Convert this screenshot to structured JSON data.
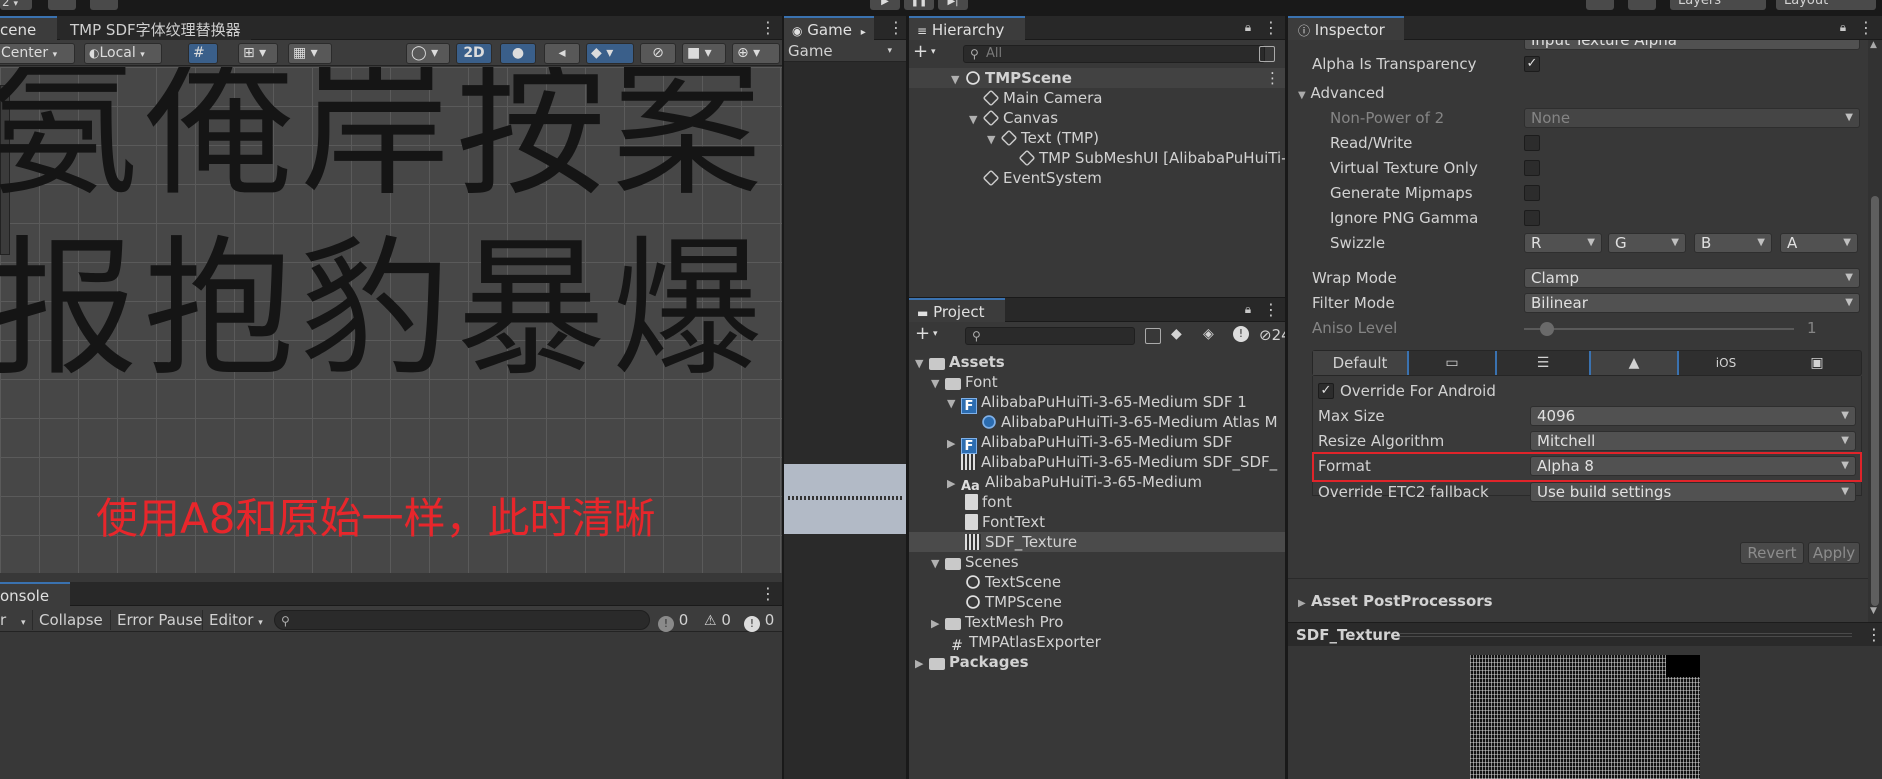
{
  "topbar": {
    "left_value": "2",
    "layers": "Layers",
    "layout": "Layout"
  },
  "scene": {
    "tabs": [
      {
        "label": "cene"
      },
      {
        "label": "TMP SDF字体纹理替换器"
      }
    ],
    "toolbar": {
      "pivot": "Center",
      "space": "Local",
      "mode2d": "2D"
    },
    "glyph_row1": "氨俺岸按案",
    "glyph_row2": "报抱豹暴爆",
    "annotation": "使用A8和原始一样，此时清晰",
    "annotation_color": "#e8262b"
  },
  "console": {
    "tab": "onsole",
    "buttons": {
      "clear": "r",
      "collapse": "Collapse",
      "error_pause": "Error Pause",
      "editor": "Editor"
    },
    "counts": {
      "logs": "0",
      "warnings": "0",
      "errors": "0"
    }
  },
  "game": {
    "tab": "Game",
    "display": "Game"
  },
  "hierarchy": {
    "tab": "Hierarchy",
    "search_placeholder": "All",
    "items": [
      {
        "label": "TMPScene"
      },
      {
        "label": "Main Camera"
      },
      {
        "label": "Canvas"
      },
      {
        "label": "Text (TMP)"
      },
      {
        "label": "TMP SubMeshUI [AlibabaPuHuiTi-"
      },
      {
        "label": "EventSystem"
      }
    ]
  },
  "project": {
    "tab": "Project",
    "hidden_count": "24",
    "items": [
      {
        "label": "Assets"
      },
      {
        "label": "Font"
      },
      {
        "label": "AlibabaPuHuiTi-3-65-Medium SDF 1"
      },
      {
        "label": "AlibabaPuHuiTi-3-65-Medium Atlas M"
      },
      {
        "label": "AlibabaPuHuiTi-3-65-Medium SDF"
      },
      {
        "label": "AlibabaPuHuiTi-3-65-Medium SDF_SDF_"
      },
      {
        "label": "AlibabaPuHuiTi-3-65-Medium"
      },
      {
        "label": "font"
      },
      {
        "label": "FontText"
      },
      {
        "label": "SDF_Texture"
      },
      {
        "label": "Scenes"
      },
      {
        "label": "TextScene"
      },
      {
        "label": "TMPScene"
      },
      {
        "label": "TextMesh Pro"
      },
      {
        "label": "TMPAtlasExporter"
      },
      {
        "label": "Packages"
      }
    ]
  },
  "inspector": {
    "tab": "Inspector",
    "alpha_source_value": "Input Texture Alpha",
    "alpha_is_transparency": "Alpha Is Transparency",
    "advanced": "Advanced",
    "non_power_of_2": {
      "label": "Non-Power of 2",
      "value": "None"
    },
    "read_write": "Read/Write",
    "virtual_texture_only": "Virtual Texture Only",
    "generate_mipmaps": "Generate Mipmaps",
    "ignore_png_gamma": "Ignore PNG Gamma",
    "swizzle": {
      "label": "Swizzle",
      "r": "R",
      "g": "G",
      "b": "B",
      "a": "A"
    },
    "wrap_mode": {
      "label": "Wrap Mode",
      "value": "Clamp"
    },
    "filter_mode": {
      "label": "Filter Mode",
      "value": "Bilinear"
    },
    "aniso_level": {
      "label": "Aniso Level",
      "value": "1"
    },
    "platform_tabs": {
      "default": "Default",
      "ios": "iOS"
    },
    "override_android": "Override For Android",
    "max_size": {
      "label": "Max Size",
      "value": "4096"
    },
    "resize_algorithm": {
      "label": "Resize Algorithm",
      "value": "Mitchell"
    },
    "format": {
      "label": "Format",
      "value": "Alpha 8"
    },
    "override_etc2": {
      "label": "Override ETC2 fallback",
      "value": "Use build settings"
    },
    "revert": "Revert",
    "apply": "Apply",
    "asset_postprocessors": "Asset PostProcessors",
    "preview_title": "SDF_Texture",
    "highlight_color": "#e0242a"
  }
}
